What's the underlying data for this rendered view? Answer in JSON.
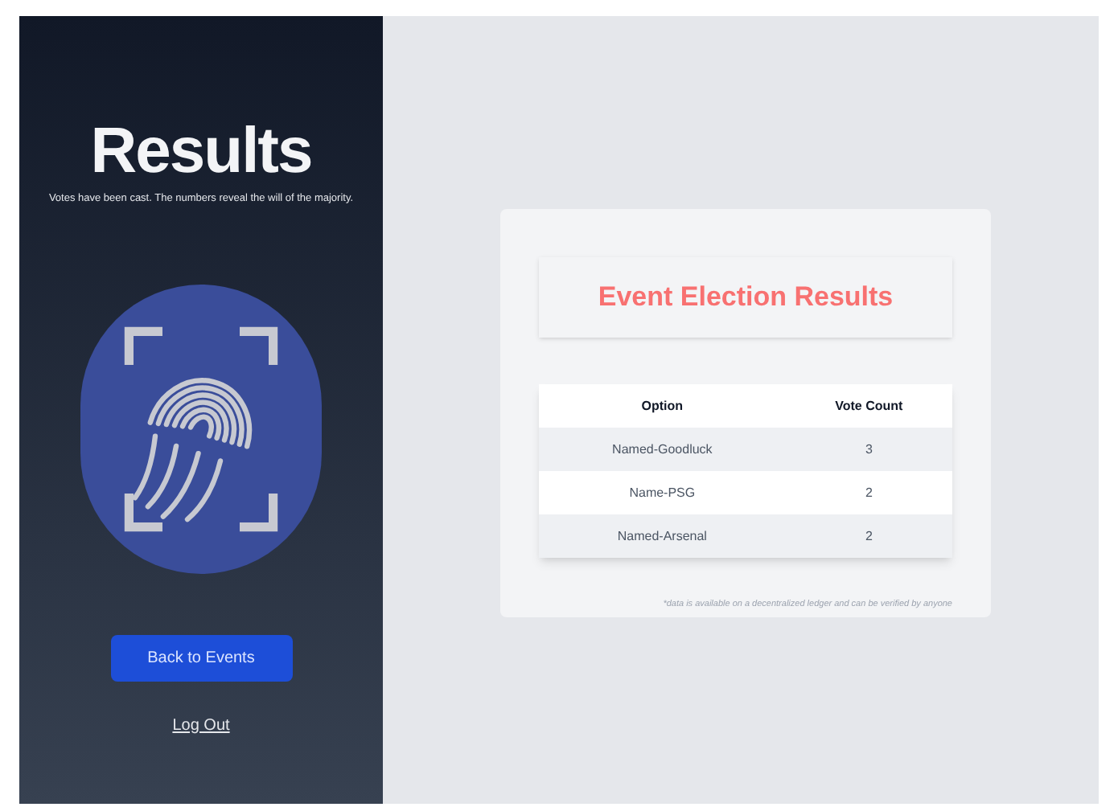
{
  "sidebar": {
    "title": "Results",
    "subtitle": "Votes have been cast. The numbers reveal the will of the majority.",
    "button": "Back to Events",
    "link": "Log Out"
  },
  "card": {
    "title": "Event Election Results",
    "table": {
      "columns": [
        "Option",
        "Vote Count"
      ],
      "rows": [
        {
          "option": "Named-Goodluck",
          "votes": "3"
        },
        {
          "option": "Name-PSG",
          "votes": "2"
        },
        {
          "option": "Named-Arsenal",
          "votes": "2"
        }
      ]
    },
    "footnote": "*data is available on a decentralized ledger and can be verified by anyone"
  }
}
